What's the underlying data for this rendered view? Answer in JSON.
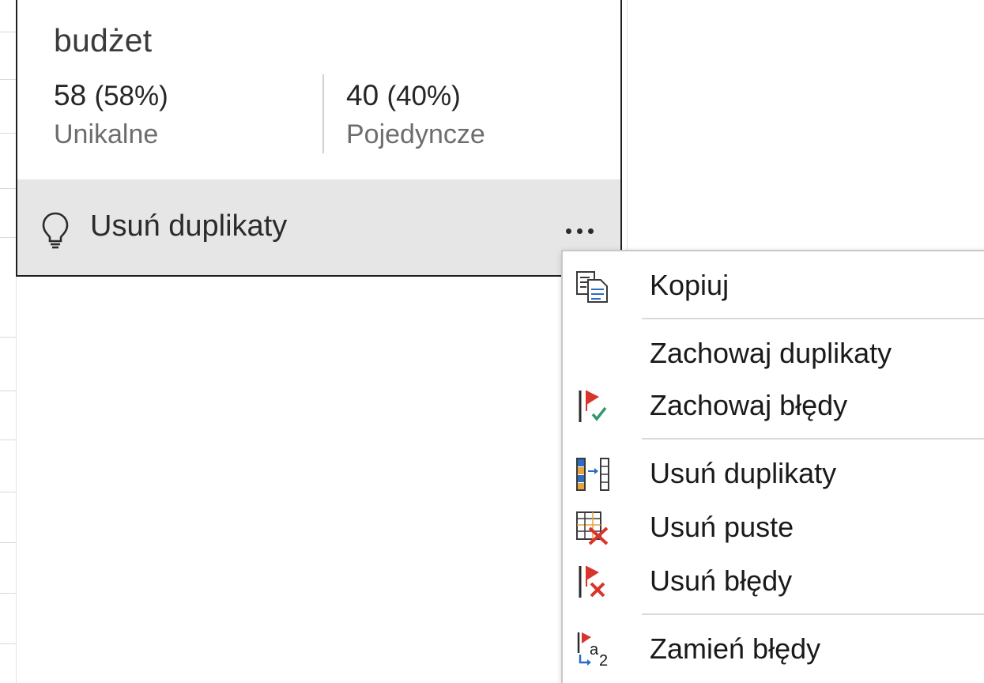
{
  "profile_card": {
    "column_name": "budżet",
    "unique": {
      "count": "58",
      "percent": "(58%)",
      "label": "Unikalne"
    },
    "single": {
      "count": "40",
      "percent": "(40%)",
      "label": "Pojedyncze"
    },
    "suggestion": {
      "icon": "lightbulb-icon",
      "label": "Usuń duplikaty"
    },
    "more_button": {
      "icon": "more-options-icon"
    }
  },
  "context_menu": {
    "items": [
      {
        "label": "Kopiuj",
        "icon": "copy-icon"
      },
      {
        "label": "Zachowaj duplikaty",
        "icon": ""
      },
      {
        "label": "Zachowaj błędy",
        "icon": "keep-errors-icon"
      },
      {
        "label": "Usuń duplikaty",
        "icon": "remove-duplicates-icon"
      },
      {
        "label": "Usuń puste",
        "icon": "remove-empty-icon"
      },
      {
        "label": "Usuń błędy",
        "icon": "remove-errors-icon"
      },
      {
        "label": "Zamień błędy",
        "icon": "replace-errors-icon"
      }
    ]
  },
  "colors": {
    "card_footer_bg": "#e6e6e6",
    "flag_red": "#d9342b",
    "check_green": "#2e9a6a",
    "accent_blue": "#2b6cc4",
    "accent_orange": "#e8a33c"
  }
}
